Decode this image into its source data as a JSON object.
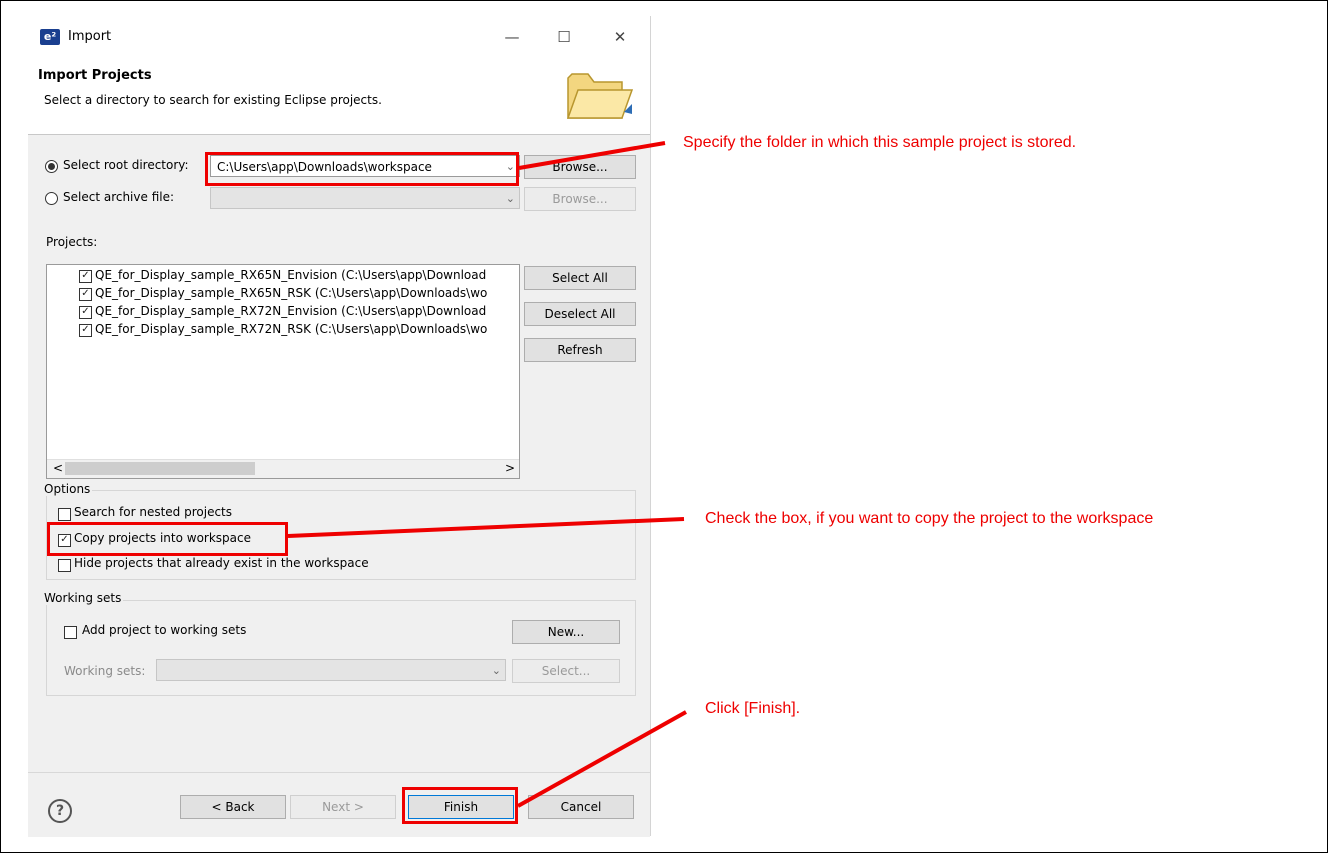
{
  "window": {
    "app_icon": "e²",
    "title": "Import",
    "minimize": "—",
    "maximize": "☐",
    "close": "✕"
  },
  "banner": {
    "title": "Import Projects",
    "description": "Select a directory to search for existing Eclipse projects.",
    "icon": "folder-icon"
  },
  "source": {
    "root_label": "Select root directory:",
    "root_value": "C:\\Users\\app\\Downloads\\workspace",
    "root_browse": "Browse...",
    "archive_label": "Select archive file:",
    "archive_value": "",
    "archive_browse": "Browse..."
  },
  "projects": {
    "label": "Projects:",
    "items": [
      {
        "label": "QE_for_Display_sample_RX65N_Envision (C:\\Users\\app\\Download",
        "checked": true
      },
      {
        "label": "QE_for_Display_sample_RX65N_RSK (C:\\Users\\app\\Downloads\\wo",
        "checked": true
      },
      {
        "label": "QE_for_Display_sample_RX72N_Envision (C:\\Users\\app\\Download",
        "checked": true
      },
      {
        "label": "QE_for_Display_sample_RX72N_RSK (C:\\Users\\app\\Downloads\\wo",
        "checked": true
      }
    ],
    "select_all": "Select All",
    "deselect_all": "Deselect All",
    "refresh": "Refresh",
    "scroll_left": "<",
    "scroll_right": ">"
  },
  "options": {
    "label": "Options",
    "nested": "Search for nested projects",
    "copy": "Copy projects into workspace",
    "hide": "Hide projects that already exist in the workspace",
    "check_mark": "✓"
  },
  "working_sets": {
    "label": "Working sets",
    "add": "Add project to working sets",
    "new": "New...",
    "field_label": "Working sets:",
    "select": "Select..."
  },
  "footer": {
    "help": "?",
    "back": "< Back",
    "next": "Next >",
    "finish": "Finish",
    "cancel": "Cancel"
  },
  "annotations": {
    "folder_note": "Specify the folder in which this sample project is stored.",
    "copy_note": "Check the box, if you want to copy the project to the workspace",
    "finish_note": "Click [Finish].",
    "color": "#ee0000"
  }
}
